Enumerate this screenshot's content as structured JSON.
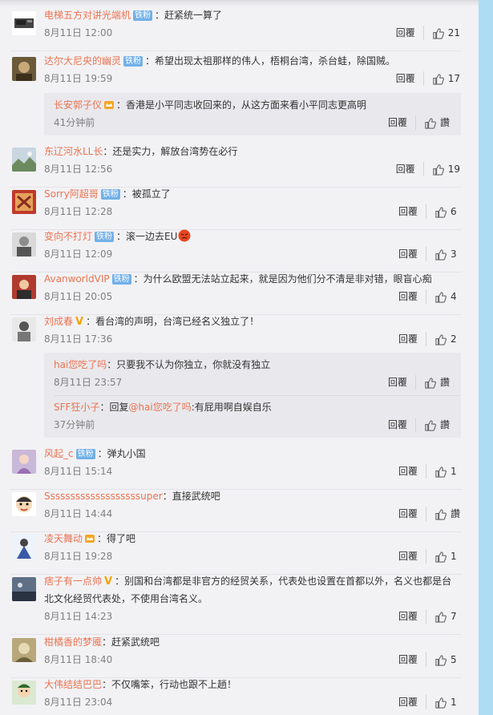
{
  "comments": [
    {
      "user": "电梯五方对讲光端机",
      "badge": "铁粉",
      "text": "：赶紧统一算了",
      "time": "8月11日 12:00",
      "reply": "回覆",
      "likes": "21"
    },
    {
      "user": "达尔大尼央的幽灵",
      "badge": "铁粉",
      "text": "：希望出现太祖那样的伟人，梧桐台湾，杀台蛙，除国贼。",
      "time": "8月11日 19:59",
      "reply": "回覆",
      "likes": "17"
    },
    {
      "user": "东辽河水LL长",
      "text": "：还是实力，解放台湾势在必行",
      "time": "8月11日 12:56",
      "reply": "回覆",
      "likes": "19"
    },
    {
      "user": "Sorry阿超哥",
      "badge": "铁粉",
      "text": "：被孤立了",
      "time": "8月11日 12:28",
      "reply": "回覆",
      "likes": "6"
    },
    {
      "user": "变向不打灯",
      "badge": "铁粉",
      "text": "：滚一边去EU",
      "time": "8月11日 12:09",
      "reply": "回覆",
      "likes": "3"
    },
    {
      "user": "AvanworldVIP",
      "badge": "铁粉",
      "text": "：为什么欧盟无法站立起来，就是因为他们分不清是非对错，眼盲心痴",
      "time": "8月11日 20:05",
      "reply": "回覆",
      "likes": "4"
    },
    {
      "user": "刘成春",
      "text": "：看台湾的声明，台湾已经名义独立了！",
      "time": "8月11日 17:36",
      "reply": "回覆",
      "likes": "2"
    },
    {
      "user": "风起_c",
      "badge": "铁粉",
      "text": "：弹丸小国",
      "time": "8月11日 15:14",
      "reply": "回覆",
      "likes": "1"
    },
    {
      "user": "Sssssssssssssssssssuper",
      "text": "：直接武统吧",
      "time": "8月11日 14:44",
      "reply": "回覆",
      "likes": "讚"
    },
    {
      "user": "凌天舞动",
      "text": "：得了吧",
      "time": "8月11日 19:28",
      "reply": "回覆",
      "likes": "1"
    },
    {
      "user": "痞子有一点帅",
      "text": "：别国和台湾都是非官方的经贸关系，代表处也设置在首都以外，名义也都是台",
      "text2": "北文化经贸代表处，不使用台湾名义。",
      "time": "8月11日 14:23",
      "reply": "回覆",
      "likes": "7"
    },
    {
      "user": "柑橘香的梦魇",
      "text": "：赶紧武统吧",
      "time": "8月11日 18:40",
      "reply": "回覆",
      "likes": "5"
    },
    {
      "user": "大伟结结巴巴",
      "text": "：不仅嘴笨，行动也跟不上趟！",
      "time": "8月11日 23:04",
      "reply": "回覆",
      "likes": "1"
    }
  ],
  "subreplies": [
    {
      "user": "长安郭子仪",
      "text": "：香港是小平同志收回来的，从这方面来看小平同志更高明",
      "time": "41分钟前",
      "reply": "回覆",
      "likes": "讚"
    },
    {
      "user": "hai您吃了吗",
      "text": "：只要我不认为你独立，你就没有独立",
      "time": "8月11日 23:57",
      "reply": "回覆",
      "likes": "讚"
    },
    {
      "user": "SFF狂小子",
      "text": "：回复",
      "mention": "@hai您吃了吗",
      "text_b": ":有屁用啊自娱自乐",
      "time": "37分钟前",
      "reply": "回覆",
      "likes": "讚"
    }
  ],
  "icons": {
    "like": "thumbs-up-icon",
    "vip": "v-verified-icon",
    "crown": "crown-badge-icon",
    "emoji": "angry-face-emoji"
  },
  "colors": {
    "username": "#eb7350",
    "badge": "#72b0e8",
    "background": "#f2f2f5",
    "sidebar": "#aedcf3"
  }
}
